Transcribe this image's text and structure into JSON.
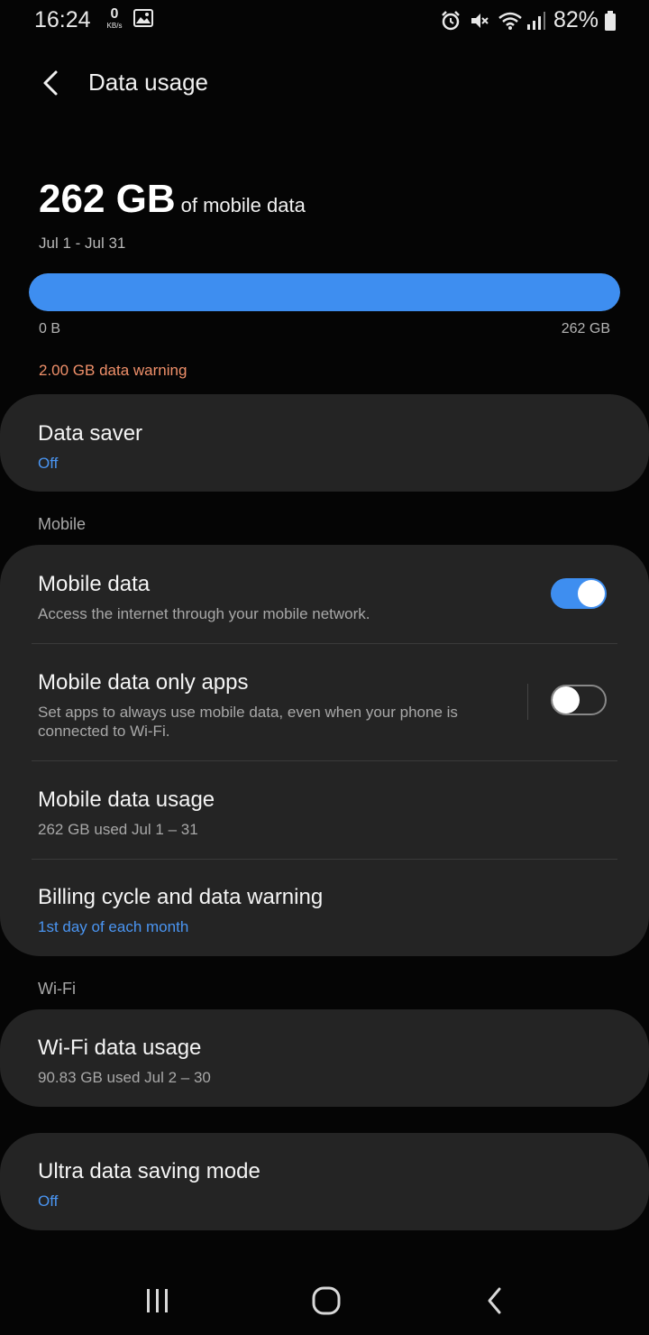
{
  "status_bar": {
    "time": "16:24",
    "net_speed_value": "0",
    "net_speed_unit": "KB/s",
    "battery_percent": "82%",
    "icons": [
      "image-icon",
      "alarm-icon",
      "mute-icon",
      "wifi-icon",
      "signal-icon",
      "battery-icon"
    ]
  },
  "header": {
    "back_icon": "chevron-left-icon",
    "title": "Data usage"
  },
  "summary": {
    "amount": "262 GB",
    "amount_suffix": "of mobile data",
    "period": "Jul 1 - Jul 31",
    "progress_fraction": 1.0,
    "progress_min_label": "0 B",
    "progress_max_label": "262 GB",
    "warning_text": "2.00 GB data warning"
  },
  "data_saver": {
    "title": "Data saver",
    "status": "Off"
  },
  "mobile_section": {
    "label": "Mobile",
    "mobile_data": {
      "title": "Mobile data",
      "subtitle": "Access the internet through your mobile network.",
      "enabled": true
    },
    "mobile_data_only_apps": {
      "title": "Mobile data only apps",
      "subtitle": "Set apps to always use mobile data, even when your phone is connected to Wi-Fi.",
      "enabled": false
    },
    "mobile_data_usage": {
      "title": "Mobile data usage",
      "subtitle": "262 GB used Jul 1 – 31"
    },
    "billing_cycle": {
      "title": "Billing cycle and data warning",
      "subtitle": "1st day of each month"
    }
  },
  "wifi_section": {
    "label": "Wi-Fi",
    "wifi_data_usage": {
      "title": "Wi-Fi data usage",
      "subtitle": "90.83 GB used Jul 2 – 30"
    }
  },
  "ultra_saving": {
    "title": "Ultra data saving mode",
    "status": "Off"
  },
  "nav_bar": {
    "icons": [
      "recent-apps-icon",
      "home-icon",
      "back-icon"
    ]
  },
  "colors": {
    "accent_blue": "#3e8ef0",
    "warning_orange": "#f0906a",
    "card_bg": "#242424",
    "page_bg": "#050505"
  }
}
